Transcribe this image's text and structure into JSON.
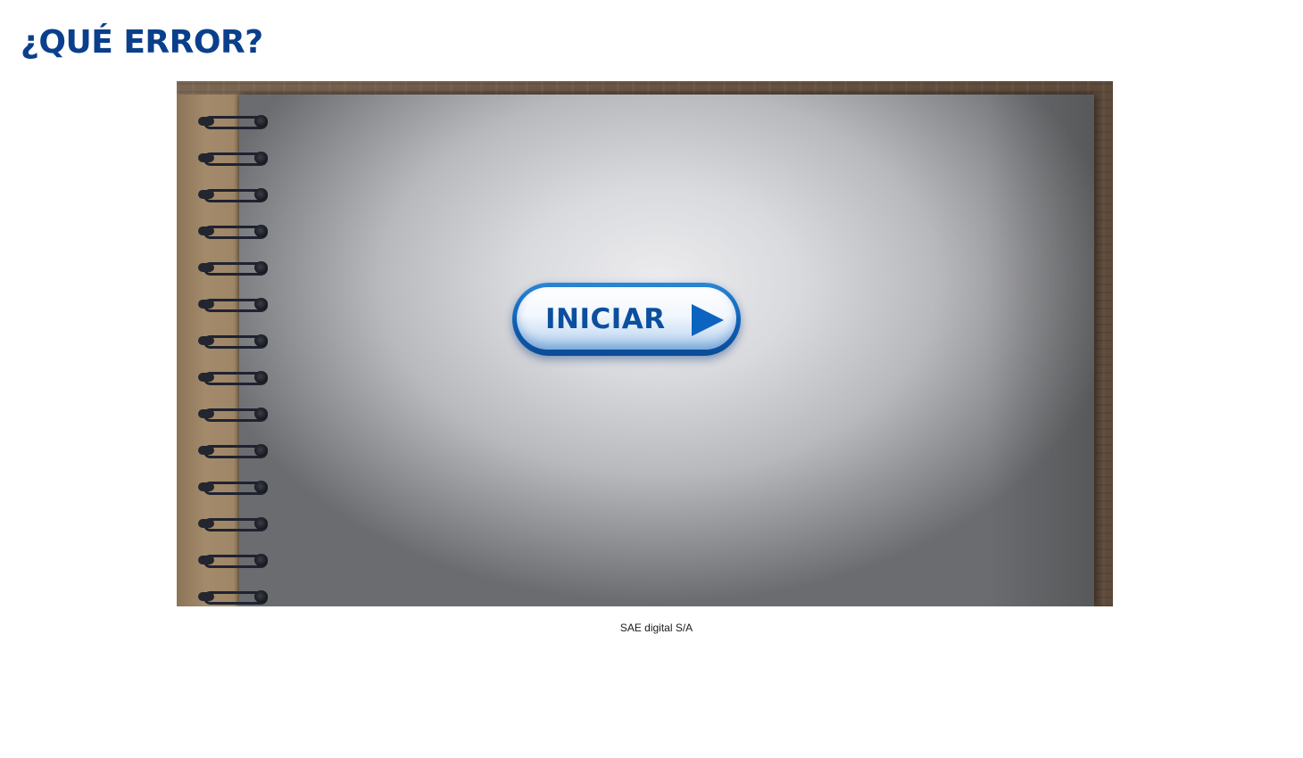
{
  "page": {
    "title": "¿QUÉ ERROR?",
    "caption": "SAE digital S/A"
  },
  "activity": {
    "start_button_label": "INICIAR",
    "start_button_icon": "play-triangle-icon",
    "background": "spiral-notebook-on-wooden-desk",
    "ring_count": 14
  },
  "colors": {
    "title": "#0a3f8c",
    "button_blue": "#0f5fb3",
    "button_label": "#0b4f9e"
  }
}
